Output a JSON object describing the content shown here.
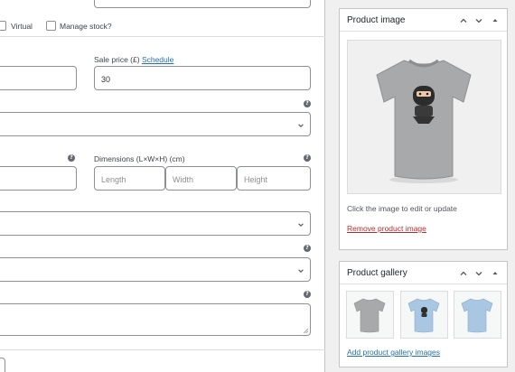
{
  "product_data": {
    "virtual_label": "Virtual",
    "manage_stock_label": "Manage stock?",
    "sale_price_label": "Sale price (£)",
    "schedule_link": "Schedule",
    "sale_price_value": "30",
    "dimensions_label": "Dimensions (L×W×H) (cm)",
    "length_placeholder": "Length",
    "width_placeholder": "Width",
    "height_placeholder": "Height"
  },
  "product_image": {
    "title": "Product image",
    "edit_hint": "Click the image to edit or update",
    "remove_link": "Remove product image"
  },
  "product_gallery": {
    "title": "Product gallery",
    "add_link": "Add product gallery images"
  },
  "colors": {
    "link": "#2271b1",
    "remove_link": "#b32d2e",
    "tshirt_grey": "#a7a9ab",
    "tshirt_blue": "#a9c7e2"
  }
}
